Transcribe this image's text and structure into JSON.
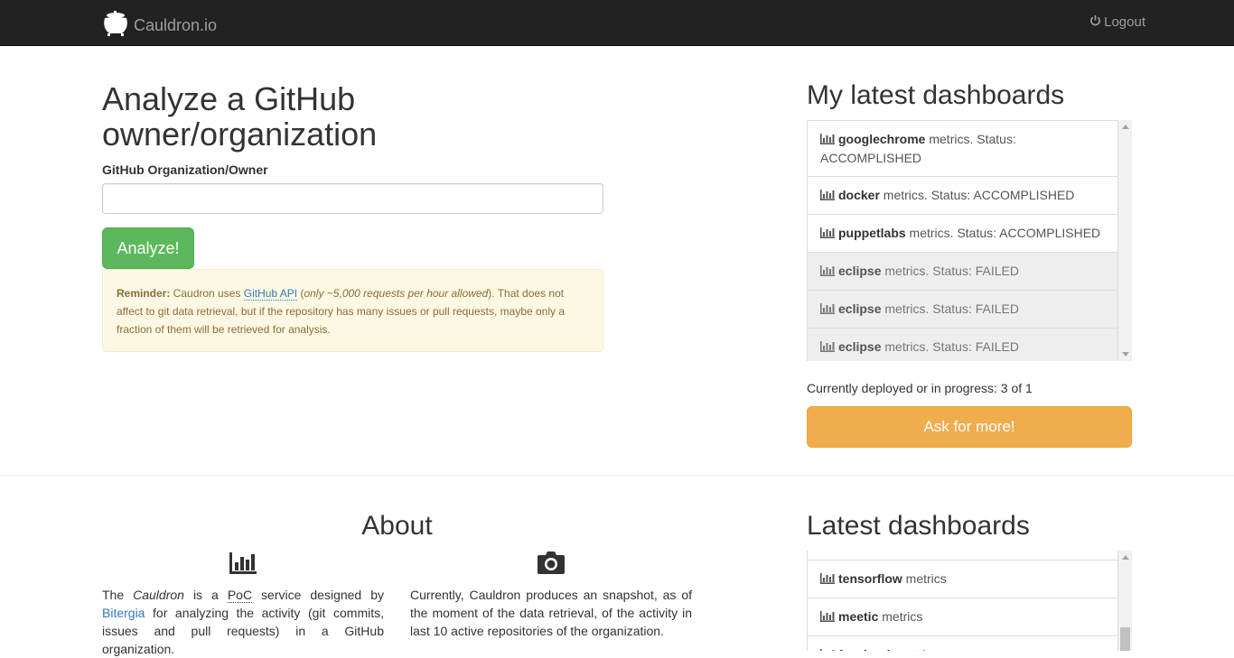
{
  "navbar": {
    "brand": "Cauldron.io",
    "logout_label": "Logout"
  },
  "analyze": {
    "title": "Analyze a GitHub owner/organization",
    "field_label": "GitHub Organization/Owner",
    "input_value": "",
    "button_label": "Analyze!",
    "reminder": {
      "prefix": "Reminder:",
      "text1": " Caudron uses ",
      "link": "GitHub API",
      "text2": " (",
      "italic": "only ~5,000 requests per hour allowed",
      "text3": "). That does not affect to git data retrieval, but if the repository has many issues or pull requests, maybe only a fraction of them will be retrieved for analysis."
    }
  },
  "my_dashboards": {
    "title": "My latest dashboards",
    "items": [
      {
        "name": "googlechrome",
        "suffix": " metrics. Status: ACCOMPLISHED",
        "status": "ACCOMPLISHED"
      },
      {
        "name": "docker",
        "suffix": " metrics. Status: ACCOMPLISHED",
        "status": "ACCOMPLISHED"
      },
      {
        "name": "puppetlabs",
        "suffix": " metrics. Status: ACCOMPLISHED",
        "status": "ACCOMPLISHED"
      },
      {
        "name": "eclipse",
        "suffix": " metrics. Status: FAILED",
        "status": "FAILED"
      },
      {
        "name": "eclipse",
        "suffix": " metrics. Status: FAILED",
        "status": "FAILED"
      },
      {
        "name": "eclipse",
        "suffix": " metrics. Status: FAILED",
        "status": "FAILED"
      }
    ],
    "deploy_text": "Currently deployed or in progress: 3 of 1",
    "ask_button": "Ask for more!"
  },
  "about": {
    "title": "About",
    "col1": {
      "t1": "The ",
      "cauldron": "Cauldron",
      "t2": " is a ",
      "poc": "PoC",
      "t3": " service designed by ",
      "bitergia": "Bitergia",
      "t4": " for analyzing the activity (git commits, issues and pull requests) in a GitHub organization."
    },
    "col2": "Currently, Cauldron produces an snapshot, as of the moment of the data retrieval, of the activity in last 10 active repositories of the organization."
  },
  "latest_dashboards": {
    "title": "Latest dashboards",
    "items": [
      {
        "name": "tensorflow",
        "suffix": " metrics"
      },
      {
        "name": "meetic",
        "suffix": " metrics"
      },
      {
        "name": "facebook",
        "suffix": " metrics"
      }
    ]
  },
  "colors": {
    "navbar": "#222222",
    "success": "#5cb85c",
    "warning": "#f0ad4e",
    "link": "#337ab7",
    "alert_bg": "#fcf8e3"
  },
  "icons": [
    "cauldron-logo-icon",
    "power-icon",
    "bar-chart-icon",
    "camera-icon"
  ]
}
